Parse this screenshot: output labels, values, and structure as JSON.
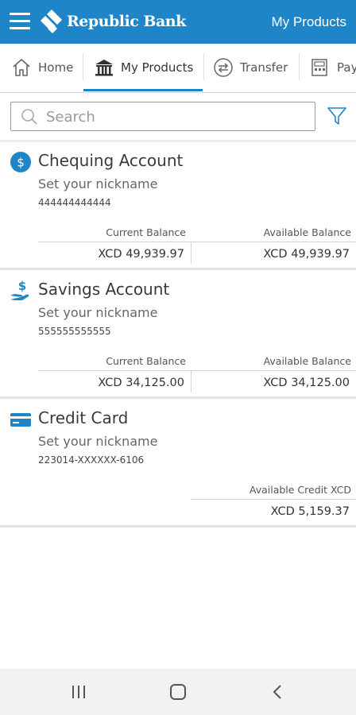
{
  "header": {
    "brand": "Republic Bank",
    "title": "My Products"
  },
  "tabs": [
    {
      "label": "Home",
      "icon": "home-icon"
    },
    {
      "label": "My Products",
      "icon": "bank-icon"
    },
    {
      "label": "Transfer",
      "icon": "transfer-icon"
    },
    {
      "label": "Pay",
      "icon": "pay-icon"
    }
  ],
  "search": {
    "placeholder": "Search"
  },
  "accounts": [
    {
      "name": "Chequing Account",
      "nickname": "Set your nickname",
      "number": "444444444444",
      "icon": "dollar-circle-icon",
      "current_label": "Current Balance",
      "current_value": "XCD 49,939.97",
      "available_label": "Available Balance",
      "available_value": "XCD 49,939.97"
    },
    {
      "name": "Savings Account",
      "nickname": "Set your nickname",
      "number": "555555555555",
      "icon": "savings-hand-icon",
      "current_label": "Current Balance",
      "current_value": "XCD 34,125.00",
      "available_label": "Available Balance",
      "available_value": "XCD 34,125.00"
    },
    {
      "name": "Credit Card",
      "nickname": "Set your nickname",
      "number": "223014-XXXXXX-6106",
      "icon": "credit-card-icon",
      "available_label": "Available Credit XCD",
      "available_value": "XCD 5,159.37"
    }
  ],
  "colors": {
    "brand_blue": "#1e86c8",
    "divider": "#d4d4d4"
  }
}
